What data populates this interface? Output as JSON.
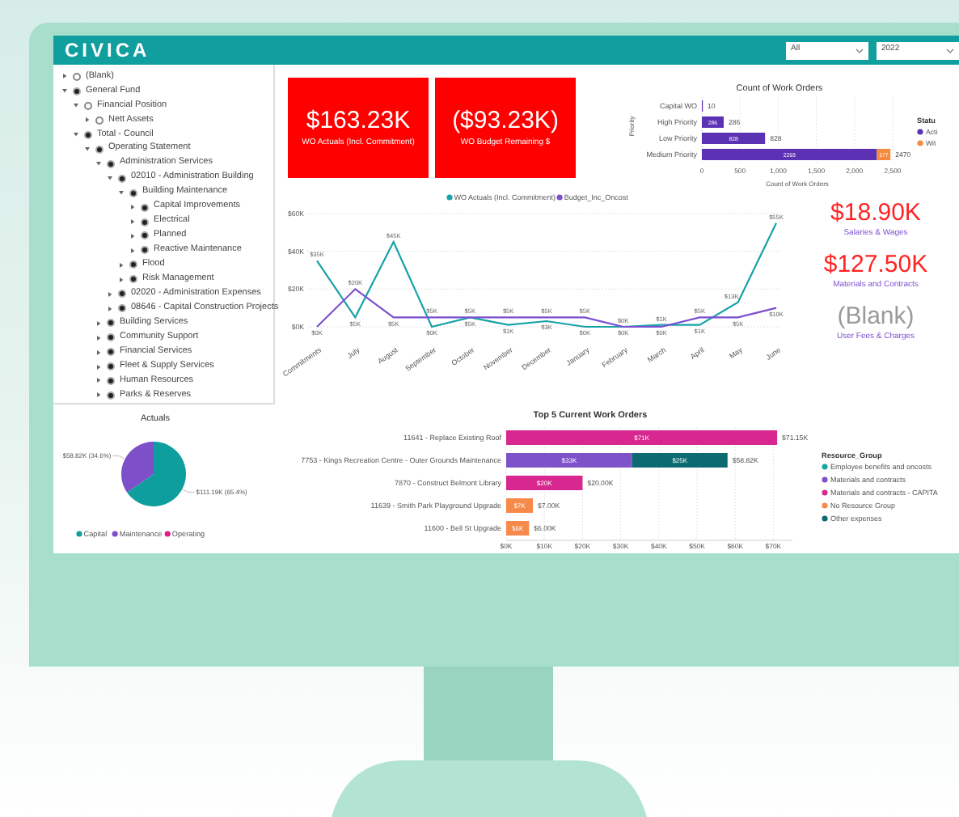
{
  "header": {
    "logo": "CIVICA",
    "filters": [
      {
        "value": "All"
      },
      {
        "value": "2022"
      }
    ]
  },
  "tree": [
    {
      "label": "(Blank)",
      "expanded": false,
      "selected": false
    },
    {
      "label": "General Fund",
      "expanded": true,
      "selected": true,
      "children": [
        {
          "label": "Financial Position",
          "expanded": true,
          "selected": false,
          "children": [
            {
              "label": "Nett Assets",
              "expanded": false,
              "selected": false
            }
          ]
        },
        {
          "label": "Total - Council",
          "expanded": true,
          "selected": true,
          "children": [
            {
              "label": "Operating Statement",
              "expanded": true,
              "selected": true,
              "children": [
                {
                  "label": "Administration Services",
                  "expanded": true,
                  "selected": true,
                  "children": [
                    {
                      "label": "02010 - Administration Building",
                      "expanded": true,
                      "selected": true,
                      "children": [
                        {
                          "label": "Building Maintenance",
                          "expanded": true,
                          "selected": true,
                          "children": [
                            {
                              "label": "Capital Improvements",
                              "expanded": false,
                              "selected": true
                            },
                            {
                              "label": "Electrical",
                              "expanded": false,
                              "selected": true
                            },
                            {
                              "label": "Planned",
                              "expanded": false,
                              "selected": true
                            },
                            {
                              "label": "Reactive Maintenance",
                              "expanded": false,
                              "selected": true
                            }
                          ]
                        },
                        {
                          "label": "Flood",
                          "expanded": false,
                          "selected": true
                        },
                        {
                          "label": "Risk Management",
                          "expanded": false,
                          "selected": true
                        }
                      ]
                    },
                    {
                      "label": "02020 - Administration Expenses",
                      "expanded": false,
                      "selected": true
                    },
                    {
                      "label": "08646 - Capital Construction Projects",
                      "expanded": false,
                      "selected": true
                    }
                  ]
                },
                {
                  "label": "Building Services",
                  "expanded": false,
                  "selected": true
                },
                {
                  "label": "Community Support",
                  "expanded": false,
                  "selected": true
                },
                {
                  "label": "Financial Services",
                  "expanded": false,
                  "selected": true
                },
                {
                  "label": "Fleet & Supply Services",
                  "expanded": false,
                  "selected": true
                },
                {
                  "label": "Human Resources",
                  "expanded": false,
                  "selected": true
                },
                {
                  "label": "Parks & Reserves",
                  "expanded": false,
                  "selected": true
                }
              ]
            }
          ]
        }
      ]
    }
  ],
  "kpi_cards": [
    {
      "value": "$163.23K",
      "label": "WO Actuals (Incl. Commitment)"
    },
    {
      "value": "($93.23K)",
      "label": "WO Budget Remaining $"
    }
  ],
  "count_orders": {
    "chart_data": {
      "type": "bar",
      "orientation": "horizontal",
      "stacked": true,
      "grid": true,
      "title": "Count of Work Orders",
      "xlabel": "Count of Work Orders",
      "ylabel": "Priority",
      "legend": {
        "title": "Statu"
      },
      "categories": [
        "Capital WO",
        "High Priority",
        "Low Priority",
        "Medium Priority"
      ],
      "series": [
        {
          "name": "Acti",
          "color": "#5b32b4",
          "values": [
            10,
            286,
            828,
            2293
          ],
          "value_labels": [
            null,
            "286",
            "828",
            "2293"
          ]
        },
        {
          "name": "Wit",
          "color": "#f58a3e",
          "values": [
            null,
            null,
            null,
            177
          ],
          "value_labels": [
            null,
            null,
            null,
            "177"
          ]
        }
      ],
      "xlim": [
        0,
        2500
      ],
      "xticks": [
        {
          "value": 0,
          "label": "0"
        },
        {
          "value": 500,
          "label": "500"
        },
        {
          "value": 1000,
          "label": "1,000"
        },
        {
          "value": 1500,
          "label": "1,500"
        },
        {
          "value": 2000,
          "label": "2,000"
        },
        {
          "value": 2500,
          "label": "2,500"
        }
      ],
      "value_labels": [
        "10",
        "286",
        "828",
        "2470"
      ]
    }
  },
  "monthly": {
    "chart_data": {
      "type": "line",
      "grid": true,
      "legend": true,
      "categories": [
        "Commitments",
        "July",
        "August",
        "September",
        "October",
        "November",
        "December",
        "January",
        "February",
        "March",
        "April",
        "May",
        "June"
      ],
      "series": [
        {
          "name": "WO Actuals (Incl. Commitment)",
          "color": "#17a2a8",
          "values": [
            35,
            5,
            45,
            0,
            5,
            1,
            3,
            0,
            0,
            1,
            1,
            13,
            55
          ],
          "value_labels": [
            "$35K",
            "$5K",
            "$45K",
            "$0K",
            "$5K",
            "$1K",
            "$3K",
            "$0K",
            "$0K",
            "$1K",
            "$1K",
            "$13K",
            "$55K"
          ]
        },
        {
          "name": "Budget_Inc_Oncost",
          "color": "#7b4fd0",
          "values": [
            0,
            20,
            5,
            5,
            5,
            5,
            5,
            5,
            0,
            0,
            5,
            5,
            10
          ],
          "value_labels": [
            "$0K",
            "$20K",
            "$5K",
            "$5K",
            "$5K",
            "$5K",
            "$5K",
            "$5K",
            "$0K",
            "$0K",
            "$5K",
            "$5K",
            "$10K"
          ]
        }
      ],
      "ylim": [
        0,
        60
      ],
      "yticks": [
        {
          "value": 0,
          "label": "$0K"
        },
        {
          "value": 20,
          "label": "$20K"
        },
        {
          "value": 40,
          "label": "$40K"
        },
        {
          "value": 60,
          "label": "$60K"
        }
      ]
    }
  },
  "side_kpis": [
    {
      "kind": "amount",
      "value": "$18.90K",
      "label": "Salaries & Wages"
    },
    {
      "kind": "amount",
      "value": "$127.50K",
      "label": "Materials and Contracts"
    },
    {
      "kind": "blank",
      "value": "(Blank)",
      "label": "User Fees & Charges"
    }
  ],
  "actuals": {
    "chart_data": {
      "type": "pie",
      "title": "Actuals",
      "legend": true,
      "categories": [
        "Capital",
        "Maintenance",
        "Operating"
      ],
      "values": [
        65.4,
        34.6,
        0
      ],
      "colors": [
        "#0f9e9e",
        "#7d4fc8",
        "#e6178a"
      ],
      "value_labels": [
        "$111.19K (65.4%)",
        "$58.82K (34.6%)",
        null
      ]
    }
  },
  "top_work_orders": {
    "chart_data": {
      "type": "bar",
      "orientation": "horizontal",
      "stacked": true,
      "grid": true,
      "title": "Top 5 Current Work Orders",
      "legend": {
        "title": "Resource_Group"
      },
      "categories": [
        "11641 - Replace Existing Roof",
        "7753 - Kings Recreation Centre - Outer Grounds Maintenance",
        "7870 - Construct Belmont Library",
        "11639 - Smith Park Playground Upgrade",
        "11600 - Bell St Upgrade"
      ],
      "series": [
        {
          "name": "Employee benefits and oncosts",
          "color": "#1aa6a6",
          "values": [
            null,
            null,
            null,
            null,
            null
          ]
        },
        {
          "name": "Materials and contracts",
          "color": "#7e52c9",
          "values": [
            null,
            33,
            null,
            null,
            null
          ],
          "value_labels": [
            null,
            "$33K",
            null,
            null,
            null
          ]
        },
        {
          "name": "Materials and contracts - CAPITA",
          "color": "#d8288f",
          "values": [
            71,
            null,
            20,
            null,
            null
          ],
          "value_labels": [
            "$71K",
            null,
            "$20K",
            null,
            null
          ]
        },
        {
          "name": "No Resource Group",
          "color": "#f7894a",
          "values": [
            null,
            null,
            null,
            7,
            6
          ],
          "value_labels": [
            null,
            null,
            null,
            "$7K",
            "$6K"
          ]
        },
        {
          "name": "Other expenses",
          "color": "#0b6b70",
          "values": [
            null,
            25,
            null,
            null,
            null
          ],
          "value_labels": [
            null,
            "$25K",
            null,
            null,
            null
          ]
        }
      ],
      "xticks": [
        {
          "value": 0,
          "label": "$0K"
        },
        {
          "value": 10,
          "label": "$10K"
        },
        {
          "value": 20,
          "label": "$20K"
        },
        {
          "value": 30,
          "label": "$30K"
        },
        {
          "value": 40,
          "label": "$40K"
        },
        {
          "value": 50,
          "label": "$50K"
        },
        {
          "value": 60,
          "label": "$60K"
        },
        {
          "value": 70,
          "label": "$70K"
        }
      ],
      "xlim": [
        0,
        75
      ],
      "value_labels": [
        "$71.15K",
        "$58.82K",
        "$20.00K",
        "$7.00K",
        "$6.00K"
      ]
    }
  }
}
